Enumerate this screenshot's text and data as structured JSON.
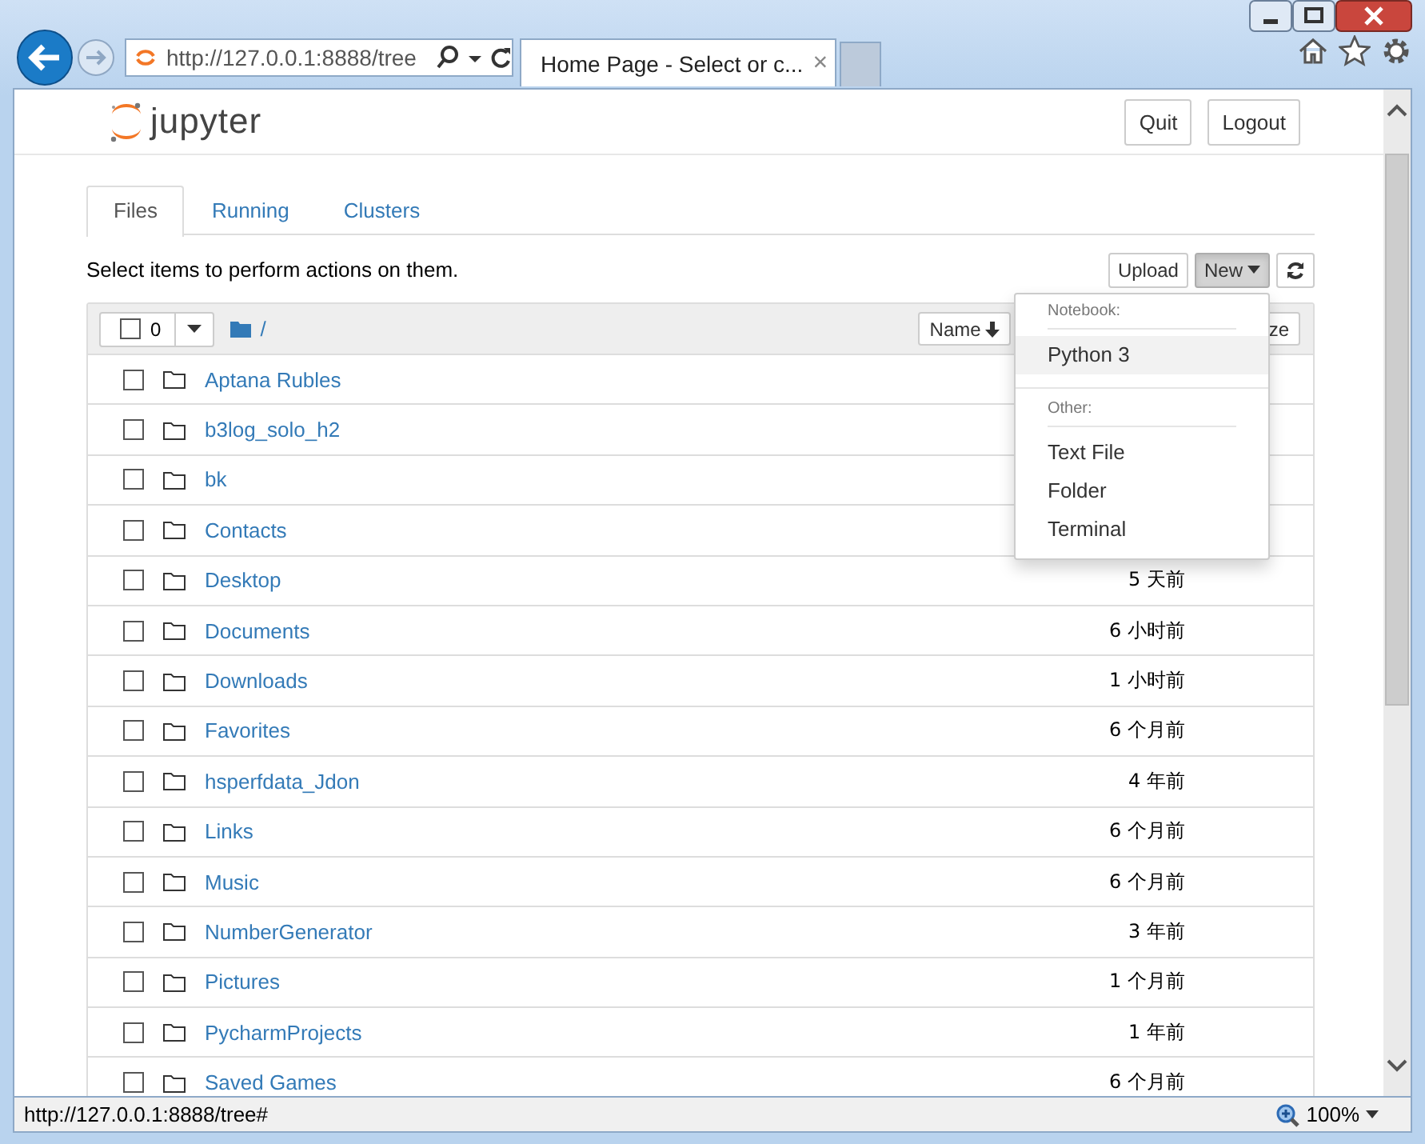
{
  "browser": {
    "address": "http://127.0.0.1:8888/tree",
    "tab_title": "Home Page - Select or c...",
    "tab_close": "×"
  },
  "header": {
    "logo_text": "jupyter",
    "buttons": [
      "Quit",
      "Logout"
    ]
  },
  "tabs": [
    {
      "label": "Files",
      "selected": true
    },
    {
      "label": "Running",
      "selected": false
    },
    {
      "label": "Clusters",
      "selected": false
    }
  ],
  "hint": "Select items to perform actions on them.",
  "toolbar": {
    "upload": "Upload",
    "new": {
      "label": "New",
      "expanded": true
    }
  },
  "list_header": {
    "selected_count": "0",
    "path": "/",
    "sort_button": "Name",
    "column_3": "ze"
  },
  "rows": [
    {
      "name": "Aptana Rubles",
      "checked": false
    },
    {
      "name": "b3log_solo_h2",
      "checked": false
    },
    {
      "name": "bk",
      "checked": false
    },
    {
      "name": "Contacts",
      "checked": false
    },
    {
      "name": "Desktop",
      "checked": false,
      "modified": "5 天前"
    },
    {
      "name": "Documents",
      "checked": false,
      "modified": "6 小时前"
    },
    {
      "name": "Downloads",
      "checked": false,
      "modified": "1 小时前"
    },
    {
      "name": "Favorites",
      "checked": false,
      "modified": "6 个月前"
    },
    {
      "name": "hsperfdata_Jdon",
      "checked": false,
      "modified": "4 年前"
    },
    {
      "name": "Links",
      "checked": false,
      "modified": "6 个月前"
    },
    {
      "name": "Music",
      "checked": false,
      "modified": "6 个月前"
    },
    {
      "name": "NumberGenerator",
      "checked": false,
      "modified": "3 年前"
    },
    {
      "name": "Pictures",
      "checked": false,
      "modified": "1 个月前"
    },
    {
      "name": "PycharmProjects",
      "checked": false,
      "modified": "1 年前"
    },
    {
      "name": "Saved Games",
      "checked": false,
      "modified": "6 个月前"
    }
  ],
  "menu": {
    "sections": [
      {
        "heading": "Notebook:",
        "items": [
          {
            "label": "Python 3",
            "selected": true
          }
        ]
      },
      {
        "heading": "Other:",
        "items": [
          {
            "label": "Text File",
            "selected": false
          },
          {
            "label": "Folder",
            "selected": false
          },
          {
            "label": "Terminal",
            "selected": false
          }
        ]
      }
    ]
  },
  "status_bar": {
    "url": "http://127.0.0.1:8888/tree#",
    "zoom": "100%"
  }
}
